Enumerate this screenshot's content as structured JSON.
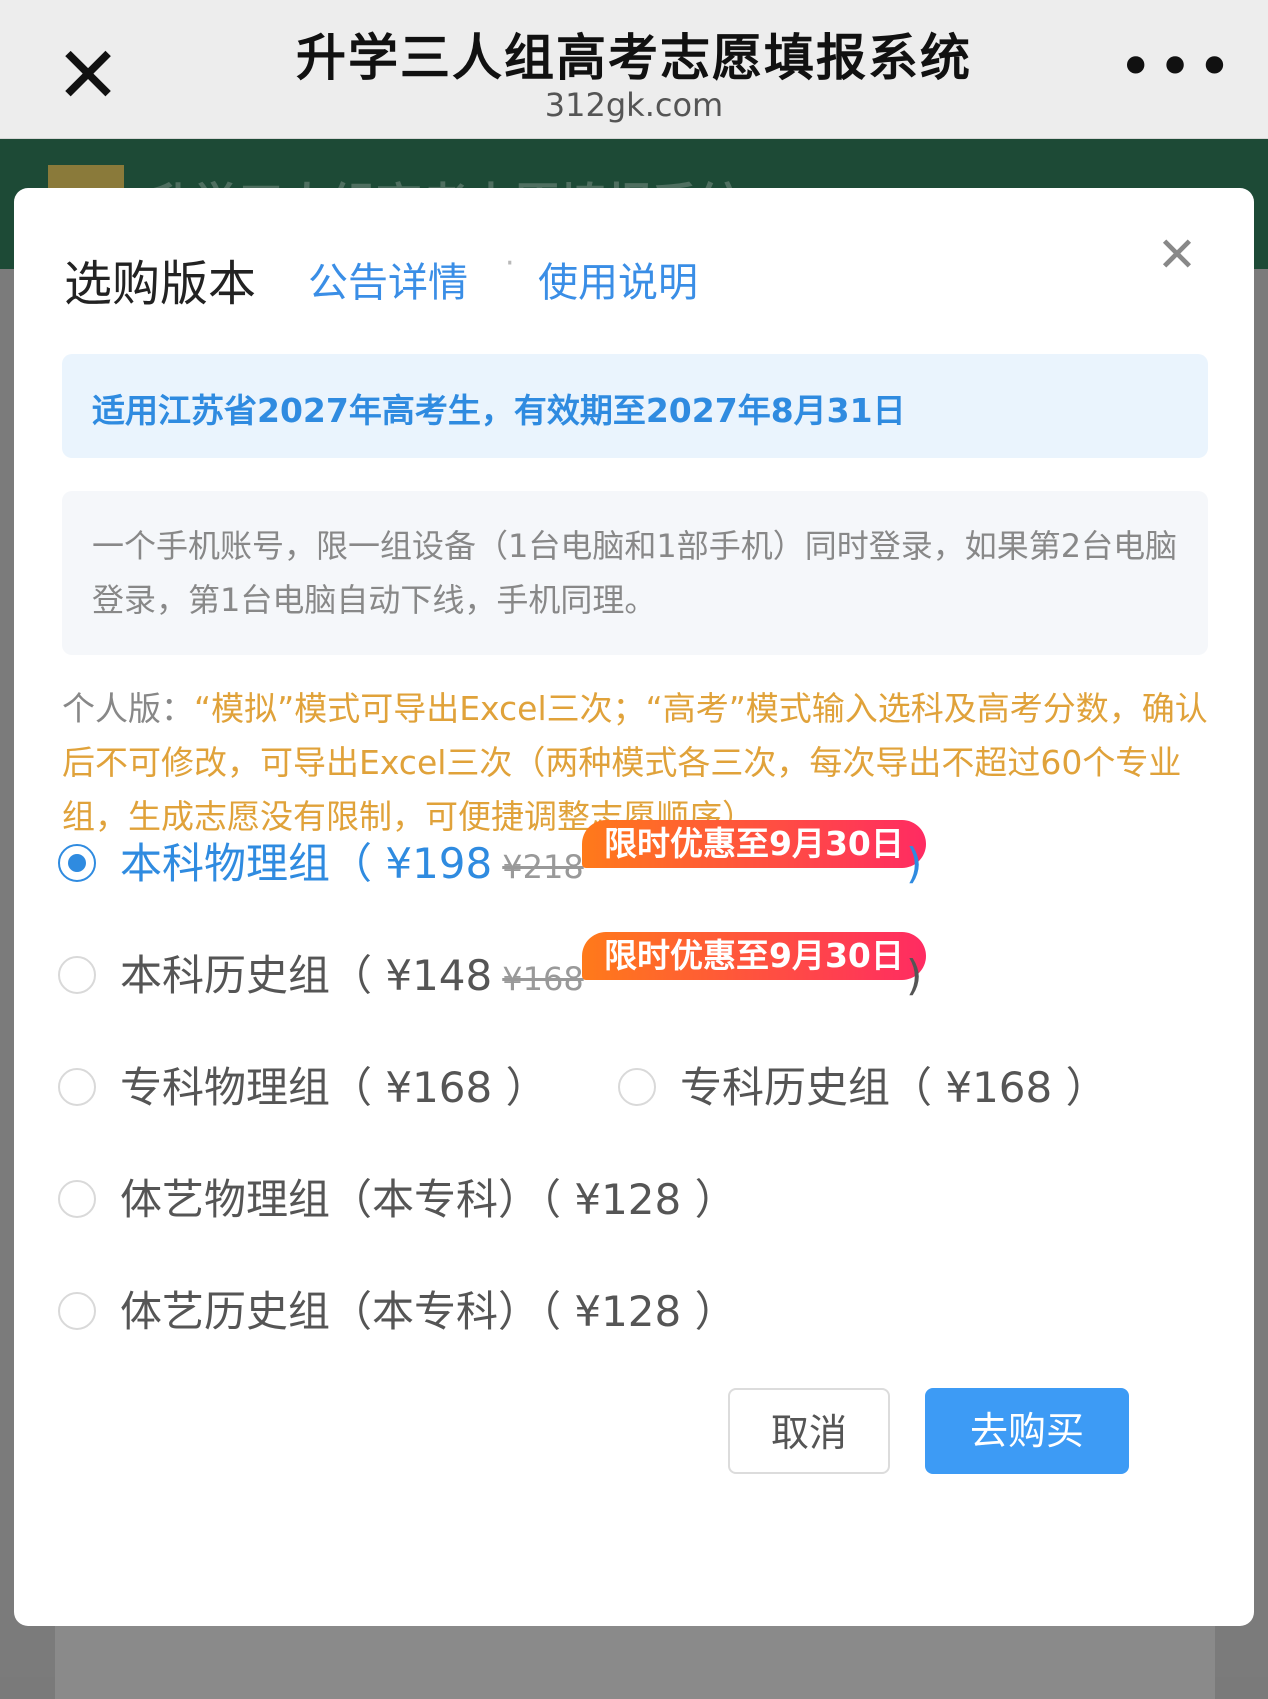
{
  "topbar": {
    "title": "升学三人组高考志愿填报系统",
    "domain": "312gk.com"
  },
  "background": {
    "header_text": "升学三人组高考志愿填报系统"
  },
  "dialog": {
    "title": "选购版本",
    "link_notice": "公告详情",
    "link_separator": "·",
    "link_guide": "使用说明",
    "info_banner": "适用江苏省2027年高考生，有效期至2027年8月31日",
    "login_rule": "一个手机账号，限一组设备（1台电脑和1部手机）同时登录，如果第2台电脑登录，第1台电脑自动下线，手机同理。",
    "note_label": "个人版：",
    "note_text": "“模拟”模式可导出Excel三次；“高考”模式输入选科及高考分数，确认后不可修改，可导出Excel三次（两种模式各三次，每次导出不超过60个专业组，生成志愿没有限制，可便捷调整志愿顺序）",
    "options": [
      {
        "label": "本科物理组（ ¥198",
        "old_price": "¥218",
        "promo": "限时优惠至9月30日",
        "close": ")",
        "selected": true
      },
      {
        "label": "本科历史组（ ¥148",
        "old_price": "¥168",
        "promo": "限时优惠至9月30日",
        "close": ")",
        "selected": false
      },
      {
        "label": "专科物理组（ ¥168 ）",
        "selected": false
      },
      {
        "label": "专科历史组（ ¥168 ）",
        "selected": false
      },
      {
        "label": "体艺物理组（本专科）（ ¥128 ）",
        "selected": false
      },
      {
        "label": "体艺历史组（本专科）（ ¥128 ）",
        "selected": false
      }
    ],
    "cancel_label": "取消",
    "buy_label": "去购买"
  },
  "colors": {
    "accent": "#2f8be0",
    "button_primary": "#3d9bf5",
    "note": "#e0a23a",
    "promo_start": "#ff7a1a",
    "promo_end": "#ff2b62",
    "page_header": "#1d4a36"
  }
}
